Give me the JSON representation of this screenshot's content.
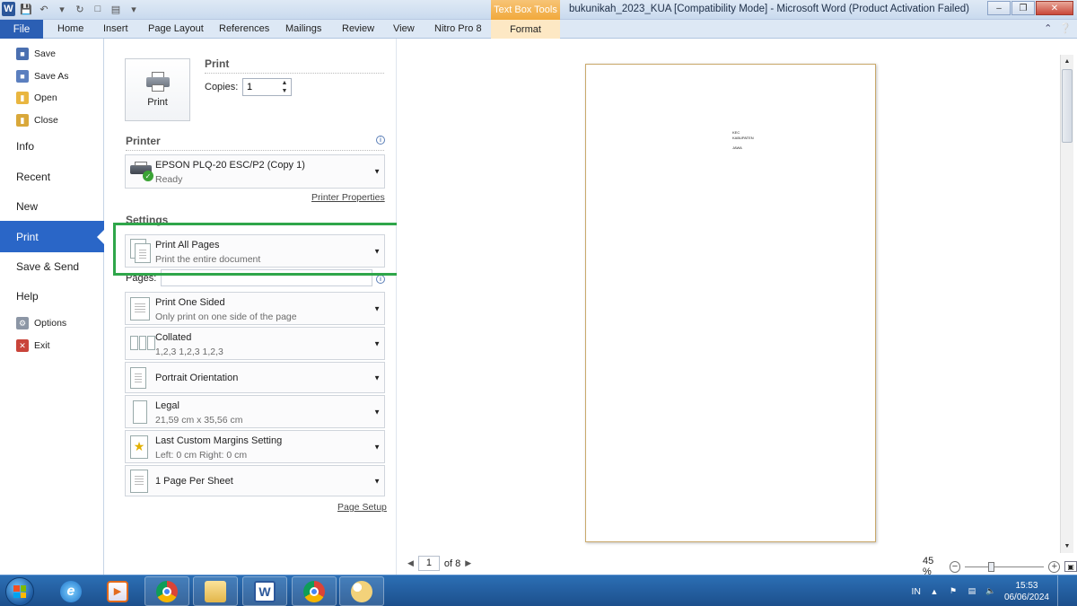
{
  "app": {
    "window_title": "bukunikah_2023_KUA [Compatibility Mode]  -  Microsoft Word (Product Activation Failed)",
    "contextual_group": "Text Box Tools",
    "logo_letter": "W"
  },
  "ribbon": {
    "file_tab": "File",
    "tabs": [
      "Home",
      "Insert",
      "Page Layout",
      "References",
      "Mailings",
      "Review",
      "View",
      "Nitro Pro 8"
    ],
    "contextual_tab": "Format"
  },
  "backstage_nav": {
    "save": "Save",
    "save_as": "Save As",
    "open": "Open",
    "close": "Close",
    "info": "Info",
    "recent": "Recent",
    "new": "New",
    "print": "Print",
    "save_send": "Save & Send",
    "help": "Help",
    "options": "Options",
    "exit": "Exit"
  },
  "print_panel": {
    "print_button_label": "Print",
    "print_heading": "Print",
    "copies_label": "Copies:",
    "copies_value": "1",
    "printer_heading": "Printer",
    "printer_name": "EPSON PLQ-20 ESC/P2 (Copy 1)",
    "printer_status": "Ready",
    "printer_properties": "Printer Properties",
    "settings_heading": "Settings",
    "pages_label": "Pages:",
    "pages_value": "",
    "settings": [
      {
        "title": "Print All Pages",
        "subtitle": "Print the entire document"
      },
      {
        "title": "Print One Sided",
        "subtitle": "Only print on one side of the page"
      },
      {
        "title": "Collated",
        "subtitle": "1,2,3    1,2,3    1,2,3"
      },
      {
        "title": "Portrait Orientation",
        "subtitle": ""
      },
      {
        "title": "Legal",
        "subtitle": "21,59 cm x 35,56 cm"
      },
      {
        "title": "Last Custom Margins Setting",
        "subtitle": "Left:  0 cm    Right:  0 cm"
      },
      {
        "title": "1 Page Per Sheet",
        "subtitle": ""
      }
    ],
    "page_setup": "Page Setup"
  },
  "preview": {
    "page_text_lines": [
      "KEC",
      "KABUPATEN",
      "JAWA"
    ],
    "current_page": "1",
    "page_of": "of 8",
    "zoom_level": "45 %"
  },
  "taskbar": {
    "language": "IN",
    "time": "15:53",
    "date": "06/06/2024"
  },
  "colors": {
    "file_tab": "#2b5fb4",
    "nav_active": "#2a66c7",
    "highlight_box": "#2fa64a",
    "contextual_tab": "#f1a93b"
  }
}
